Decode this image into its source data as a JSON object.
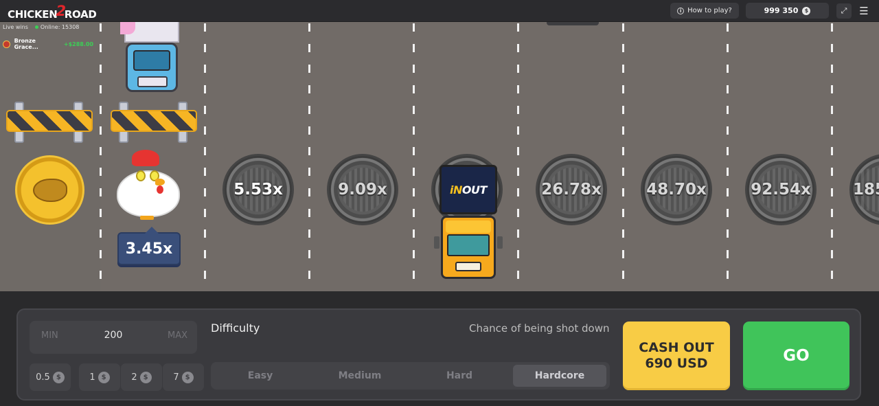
{
  "header": {
    "logo_left": "CHICKEN",
    "logo_num": "2",
    "logo_right": "ROAD",
    "how_to_play": "How to play?",
    "balance": "999 350",
    "currency_symbol": "$"
  },
  "live": {
    "label": "Live wins",
    "online": "Online: 15308",
    "winner_name": "Bronze Grace...",
    "winner_amount": "+$288.00"
  },
  "road": {
    "current_multiplier": "3.45x",
    "multipliers": [
      "5.53x",
      "9.09x",
      "26.78x",
      "48.70x",
      "92.54x",
      "185"
    ],
    "truck_logo_a": "iN",
    "truck_logo_b": "OUT"
  },
  "controls": {
    "bet_min": "MIN",
    "bet_value": "200",
    "bet_max": "MAX",
    "chips": [
      "0.5",
      "1",
      "2",
      "7"
    ],
    "chip_symbol": "$",
    "difficulty_label": "Difficulty",
    "chance_label": "Chance of being shot down",
    "difficulties": [
      "Easy",
      "Medium",
      "Hard",
      "Hardcore"
    ],
    "selected_difficulty": "Hardcore",
    "cashout_line1": "CASH OUT",
    "cashout_line2": "690 USD",
    "go_label": "GO"
  },
  "colors": {
    "cashout": "#f8cc45",
    "go": "#40c45a",
    "road": "#716b67",
    "win": "#3ccf56"
  }
}
